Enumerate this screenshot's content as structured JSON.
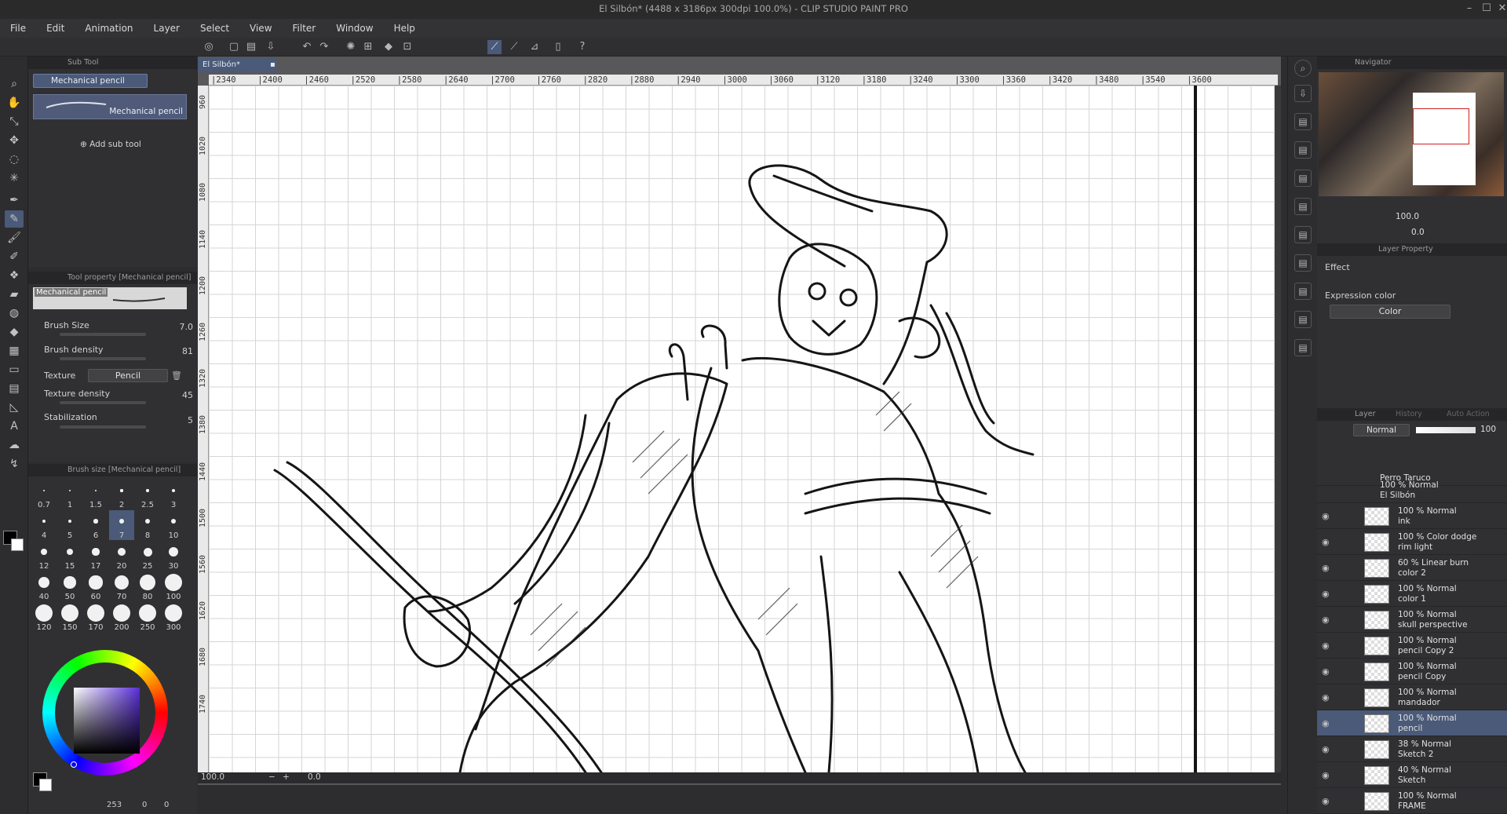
{
  "window": {
    "title": "El Silbón* (4488 x 3186px 300dpi 100.0%)  - CLIP STUDIO PAINT PRO",
    "minimize": "–",
    "maximize": "☐",
    "close": "✕"
  },
  "menu": [
    "File",
    "Edit",
    "Animation",
    "Layer",
    "Select",
    "View",
    "Filter",
    "Window",
    "Help"
  ],
  "subtool": {
    "header": "Sub Tool",
    "active_group": "Mechanical pencil",
    "preset_name": "Mechanical pencil",
    "add_sub_tool": "Add sub tool"
  },
  "tool_property": {
    "header": "Tool property [Mechanical pencil]",
    "preview_name": "Mechanical pencil",
    "brush_size_label": "Brush Size",
    "brush_size_value": "7.0",
    "brush_density_label": "Brush density",
    "brush_density_value": "81",
    "texture_label": "Texture",
    "texture_value": "Pencil",
    "texture_density_label": "Texture density",
    "texture_density_value": "45",
    "stabilization_label": "Stabilization",
    "stabilization_value": "5"
  },
  "brush_size_palette": {
    "header": "Brush size [Mechanical pencil]",
    "sizes": [
      "0.7",
      "1",
      "1.5",
      "2",
      "2.5",
      "3",
      "4",
      "5",
      "6",
      "7",
      "8",
      "10",
      "12",
      "15",
      "17",
      "20",
      "25",
      "30",
      "40",
      "50",
      "60",
      "70",
      "80",
      "100",
      "120",
      "150",
      "170",
      "200",
      "250",
      "300"
    ],
    "selected": "7"
  },
  "color_wheel": {
    "hue_color": "#5a2fd6",
    "bottom_values": [
      "253",
      "0",
      "0"
    ]
  },
  "canvas": {
    "doc_tab": "El Silbón*",
    "ruler_top": [
      "2340",
      "2400",
      "2460",
      "2520",
      "2580",
      "2640",
      "2700",
      "2760",
      "2820",
      "2880",
      "2940",
      "3000",
      "3060",
      "3120",
      "3180",
      "3240",
      "3300",
      "3360",
      "3420",
      "3480",
      "3540",
      "3600"
    ],
    "ruler_left": [
      "960",
      "1020",
      "1080",
      "1140",
      "1200",
      "1260",
      "1320",
      "1380",
      "1440",
      "1500",
      "1560",
      "1620",
      "1680",
      "1740"
    ],
    "zoom": "100.0",
    "rotation": "0.0"
  },
  "navigator": {
    "header": "Navigator",
    "zoom": "100.0",
    "rotation": "0.0"
  },
  "layer_property": {
    "header": "Layer Property",
    "effect_label": "Effect",
    "expression_color_label": "Expression color",
    "expression_color_value": "Color"
  },
  "layers": {
    "tabs": [
      "Layer",
      "History",
      "Auto Action"
    ],
    "blend_mode": "Normal",
    "opacity": "100",
    "items": [
      {
        "mode": "",
        "name": "Perro Taruco"
      },
      {
        "mode": "100 % Normal",
        "name": "El Silbón"
      },
      {
        "mode": "100 % Normal",
        "name": "ink"
      },
      {
        "mode": "100 % Color dodge",
        "name": "rim light"
      },
      {
        "mode": "60 % Linear burn",
        "name": "color 2"
      },
      {
        "mode": "100 % Normal",
        "name": "color 1"
      },
      {
        "mode": "100 % Normal",
        "name": "skull perspective"
      },
      {
        "mode": "100 % Normal",
        "name": "pencil Copy 2"
      },
      {
        "mode": "100 % Normal",
        "name": "pencil Copy"
      },
      {
        "mode": "100 % Normal",
        "name": "mandador"
      },
      {
        "mode": "100 % Normal",
        "name": "pencil"
      },
      {
        "mode": "38 % Normal",
        "name": "Sketch 2"
      },
      {
        "mode": "40 % Normal",
        "name": "Sketch"
      },
      {
        "mode": "100 % Normal",
        "name": "FRAME"
      }
    ]
  }
}
